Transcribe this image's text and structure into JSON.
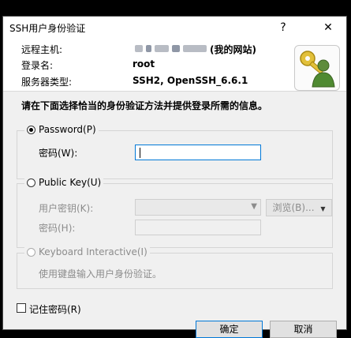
{
  "window": {
    "title": "SSH用户身份验证",
    "help_label": "?",
    "close_label": "✕"
  },
  "info": {
    "remote_host_label": "远程主机:",
    "remote_host_value_suffix": "(我的网站)",
    "login_label": "登录名:",
    "login_value": "root",
    "server_type_label": "服务器类型:",
    "server_type_value": "SSH2, OpenSSH_6.6.1"
  },
  "instruction": "请在下面选择恰当的身份验证方法并提供登录所需的信息。",
  "password_group": {
    "radio_label": "Password(P)",
    "selected": true,
    "password_label": "密码(W):",
    "password_value": ""
  },
  "publickey_group": {
    "radio_label": "Public Key(U)",
    "selected": false,
    "user_key_label": "用户密钥(K):",
    "browse_label": "浏览(B)...",
    "passphrase_label": "密码(H):"
  },
  "keyboard_group": {
    "radio_label": "Keyboard Interactive(I)",
    "selected": false,
    "description": "使用键盘输入用户身份验证。"
  },
  "remember": {
    "label": "记住密码(R)",
    "checked": false
  },
  "buttons": {
    "ok_label": "确定",
    "cancel_label": "取消"
  },
  "colors": {
    "accent": "#0078d7",
    "disabled_text": "#8c8c8c",
    "dialog_body": "#f0f0f0"
  }
}
